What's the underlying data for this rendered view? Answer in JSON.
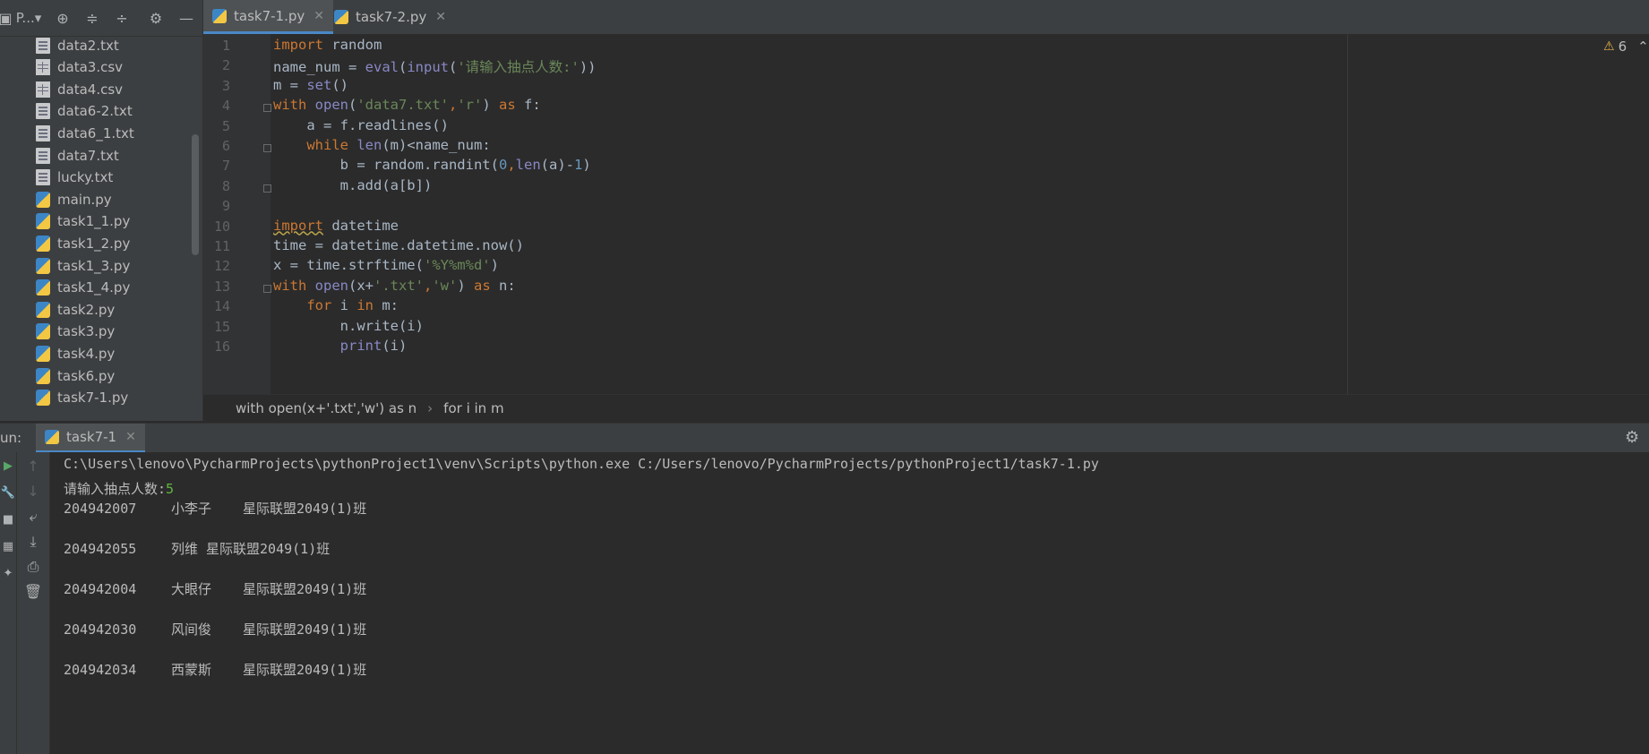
{
  "project_panel": {
    "title": "P...",
    "files": [
      {
        "name": "data2.txt",
        "type": "txt"
      },
      {
        "name": "data3.csv",
        "type": "csv"
      },
      {
        "name": "data4.csv",
        "type": "csv"
      },
      {
        "name": "data6-2.txt",
        "type": "txt"
      },
      {
        "name": "data6_1.txt",
        "type": "txt"
      },
      {
        "name": "data7.txt",
        "type": "txt"
      },
      {
        "name": "lucky.txt",
        "type": "txt"
      },
      {
        "name": "main.py",
        "type": "py"
      },
      {
        "name": "task1_1.py",
        "type": "py"
      },
      {
        "name": "task1_2.py",
        "type": "py"
      },
      {
        "name": "task1_3.py",
        "type": "py"
      },
      {
        "name": "task1_4.py",
        "type": "py"
      },
      {
        "name": "task2.py",
        "type": "py"
      },
      {
        "name": "task3.py",
        "type": "py"
      },
      {
        "name": "task4.py",
        "type": "py"
      },
      {
        "name": "task6.py",
        "type": "py"
      },
      {
        "name": "task7-1.py",
        "type": "py"
      }
    ]
  },
  "editor": {
    "tabs": [
      {
        "label": "task7-1.py",
        "active": true
      },
      {
        "label": "task7-2.py",
        "active": false
      }
    ],
    "line_numbers": [
      "1",
      "2",
      "3",
      "4",
      "5",
      "6",
      "7",
      "8",
      "9",
      "10",
      "11",
      "12",
      "13",
      "14",
      "15",
      "16"
    ],
    "lines": [
      "import random",
      "name_num = eval(input('请输入抽点人数:'))",
      "m = set()",
      "with open('data7.txt','r') as f:",
      "    a = f.readlines()",
      "    while len(m)<name_num:",
      "        b = random.randint(0,len(a)-1)",
      "        m.add(a[b])",
      "",
      "import datetime",
      "time = datetime.datetime.now()",
      "x = time.strftime('%Y%m%d')",
      "with open(x+'.txt','w') as n:",
      "    for i in m:",
      "        n.write(i)",
      "        print(i)"
    ],
    "inspection_count": "6",
    "breadcrumb": [
      "with open(x+'.txt','w') as n",
      "for i in m"
    ]
  },
  "run": {
    "label": "un:",
    "tab_label": "task7-1",
    "command": "C:\\Users\\lenovo\\PycharmProjects\\pythonProject1\\venv\\Scripts\\python.exe C:/Users/lenovo/PycharmProjects/pythonProject1/task7-1.py",
    "prompt": "请输入抽点人数:",
    "input_value": "5",
    "rows": [
      {
        "id": "204942007",
        "name": "小李子",
        "class": "星际联盟2049(1)班"
      },
      {
        "id": "204942055",
        "name": "列维 星际联盟2049(1)班",
        "class": ""
      },
      {
        "id": "204942004",
        "name": "大眼仔",
        "class": "星际联盟2049(1)班"
      },
      {
        "id": "204942030",
        "name": "风间俊",
        "class": "星际联盟2049(1)班"
      },
      {
        "id": "204942034",
        "name": "西蒙斯",
        "class": "星际联盟2049(1)班"
      }
    ]
  },
  "colors": {
    "background": "#2b2b2b",
    "panel": "#3c3f41",
    "keyword": "#cc7832",
    "string": "#6a8759",
    "number": "#6897bb",
    "builtin": "#8888c6",
    "accent": "#4a88c7"
  }
}
